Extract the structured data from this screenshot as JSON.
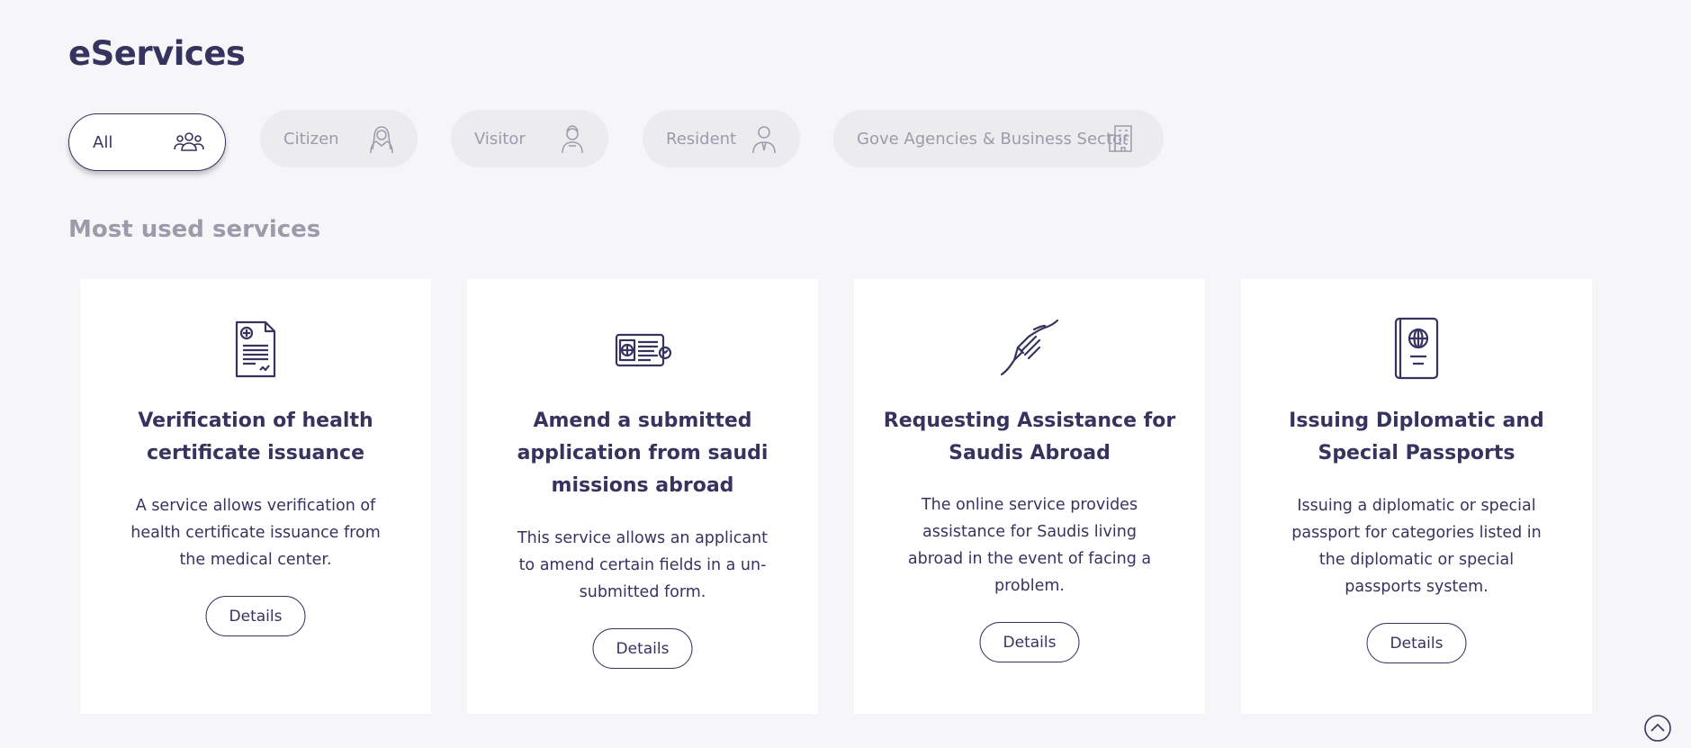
{
  "page": {
    "title": "eServices"
  },
  "filters": [
    {
      "label": "All",
      "icon": "group-icon",
      "active": true
    },
    {
      "label": "Citizen",
      "icon": "citizen-icon",
      "active": false
    },
    {
      "label": "Visitor",
      "icon": "visitor-icon",
      "active": false
    },
    {
      "label": "Resident",
      "icon": "resident-icon",
      "active": false
    },
    {
      "label": "Gove Agencies & Business Sector",
      "icon": "building-icon",
      "active": false
    }
  ],
  "section": {
    "title": "Most used services"
  },
  "cards": [
    {
      "icon": "health-certificate-icon",
      "title_lines": [
        "Verification of health",
        "certificate issuance"
      ],
      "desc_lines": [
        "A service allows verification of",
        "health certificate issuance from",
        "the medical center."
      ],
      "button": "Details"
    },
    {
      "icon": "id-card-icon",
      "title_lines": [
        "Amend a submitted",
        "application from saudi",
        "missions abroad"
      ],
      "desc_lines": [
        "This service allows an applicant",
        "to amend certain fields in a un-",
        "submitted form."
      ],
      "button": "Details"
    },
    {
      "icon": "helping-hands-icon",
      "title_lines": [
        "Requesting Assistance for",
        "Saudis Abroad"
      ],
      "desc_lines": [
        "The online service provides",
        "assistance for Saudis living",
        "abroad in the event of facing a",
        "problem."
      ],
      "button": "Details"
    },
    {
      "icon": "passport-icon",
      "title_lines": [
        "Issuing Diplomatic and",
        "Special Passports"
      ],
      "desc_lines": [
        "Issuing a diplomatic or special",
        "passport for categories listed in",
        "the diplomatic or special",
        "passports system."
      ],
      "button": "Details"
    }
  ],
  "colors": {
    "primary": "#35345f",
    "muted": "#9b9bab",
    "chip_bg": "#ececef",
    "background": "#f6f6f9"
  }
}
